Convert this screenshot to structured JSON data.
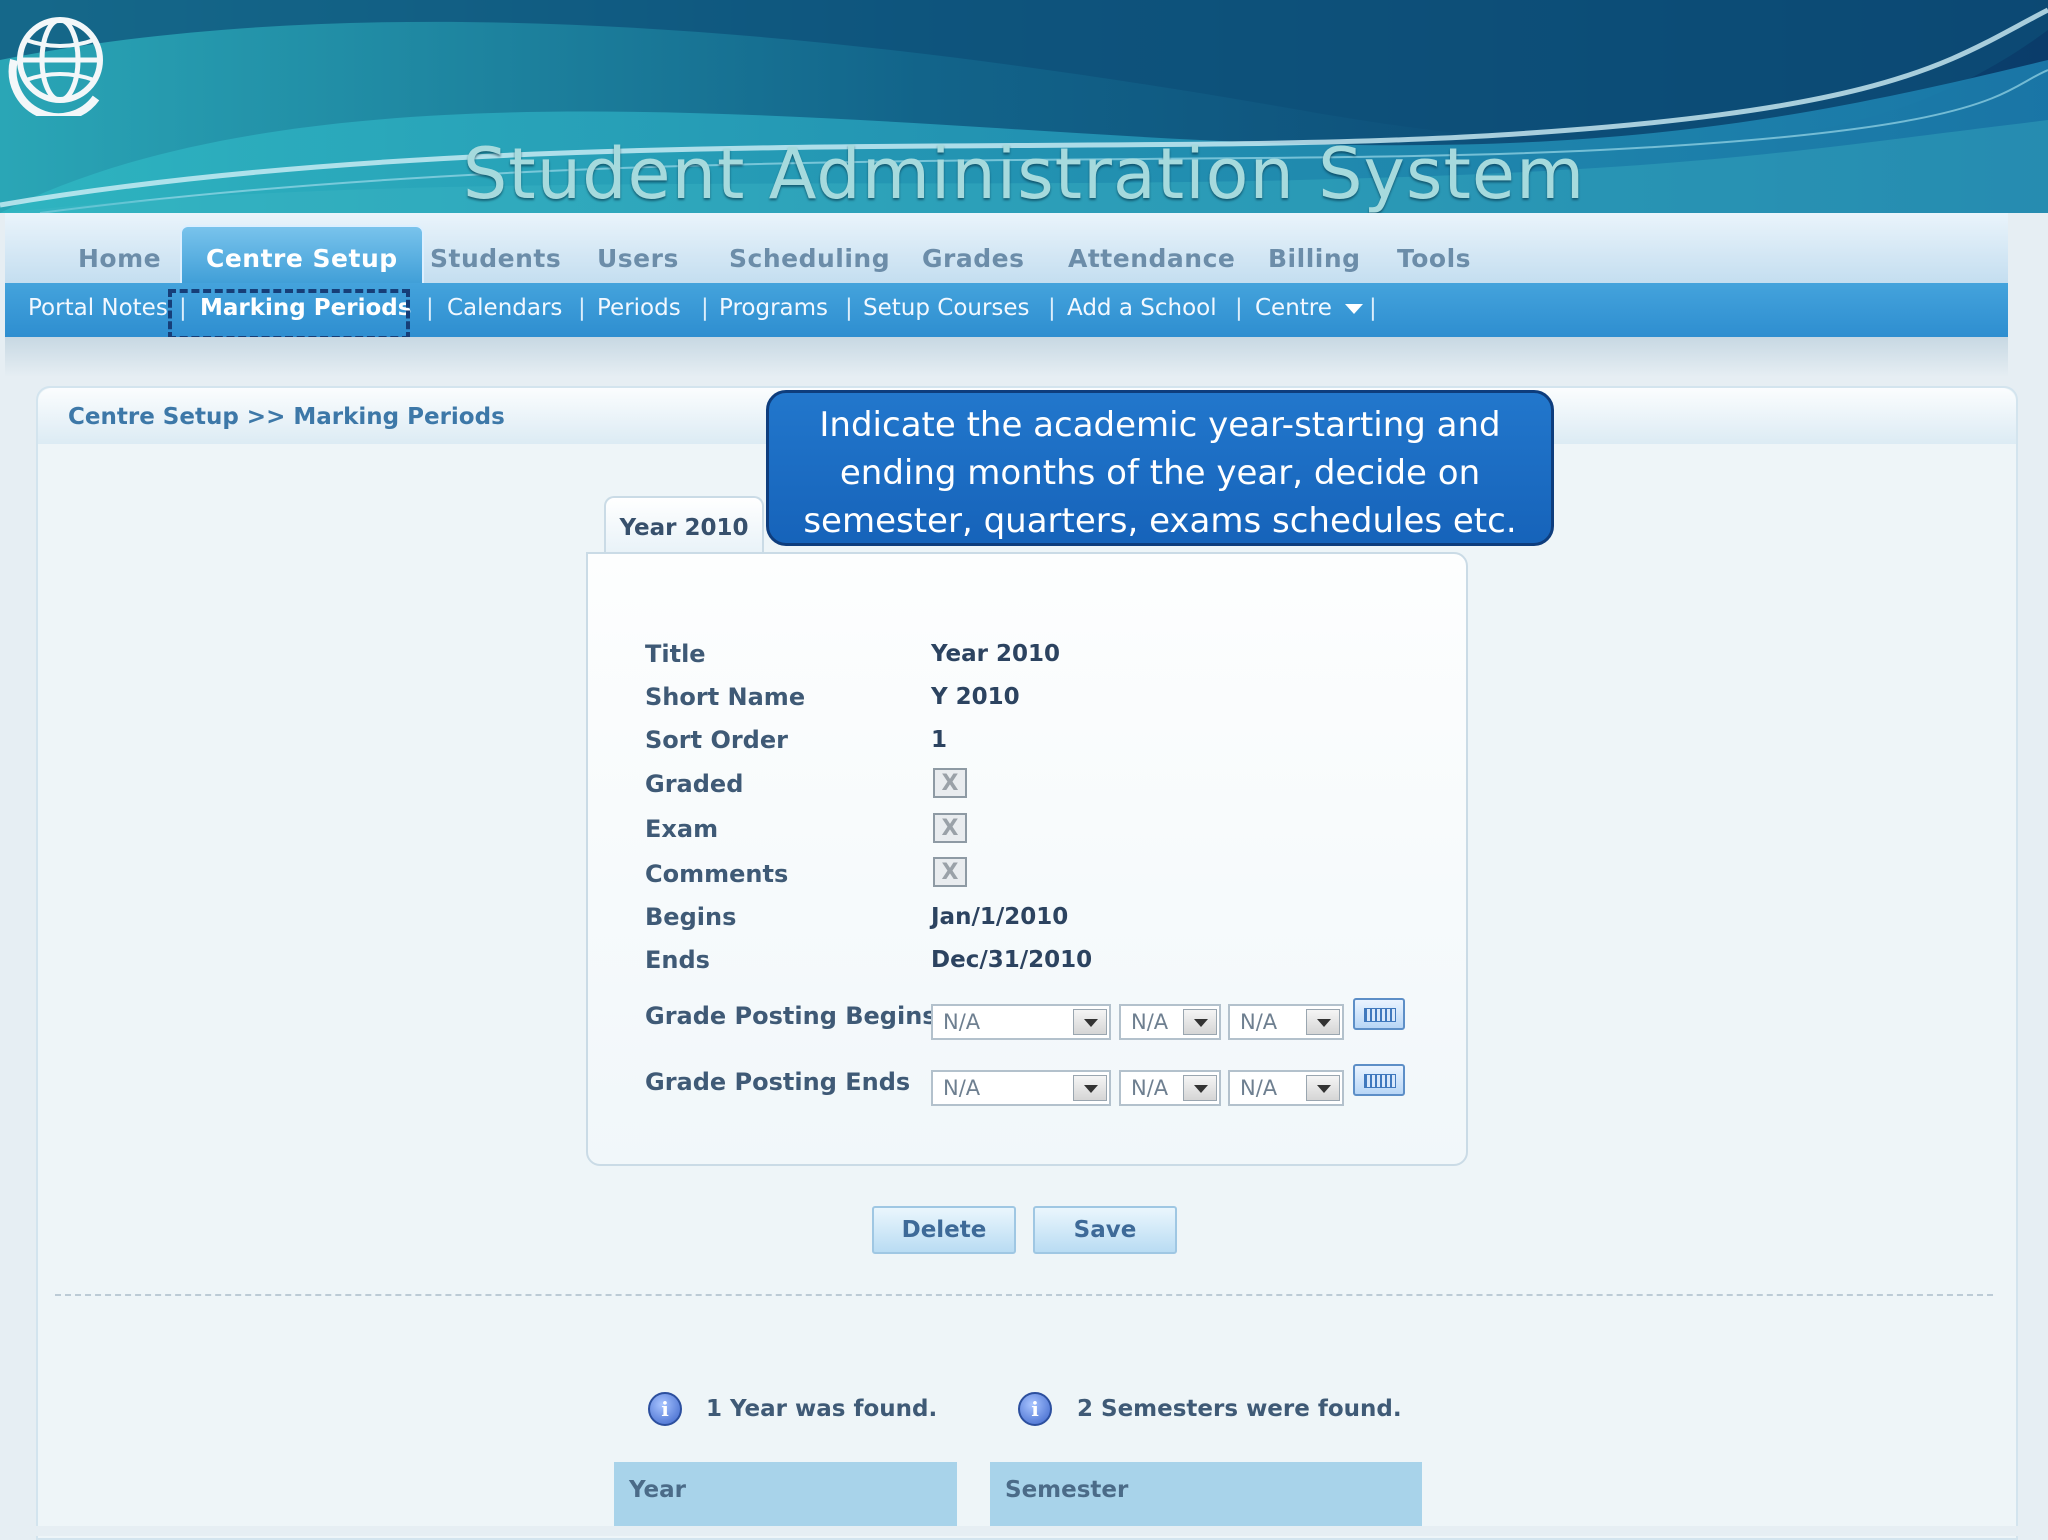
{
  "header": {
    "title": "Student Administration System"
  },
  "nav": {
    "tabs": [
      {
        "label": "Home"
      },
      {
        "label": "Centre Setup"
      },
      {
        "label": "Students"
      },
      {
        "label": "Users"
      },
      {
        "label": "Scheduling"
      },
      {
        "label": "Grades"
      },
      {
        "label": "Attendance"
      },
      {
        "label": "Billing"
      },
      {
        "label": "Tools"
      }
    ],
    "active_tab": "Centre Setup",
    "sub_items": [
      {
        "label": "Portal Notes"
      },
      {
        "label": "Marking Periods"
      },
      {
        "label": "Calendars"
      },
      {
        "label": "Periods"
      },
      {
        "label": "Programs"
      },
      {
        "label": "Setup Courses"
      },
      {
        "label": "Add a School"
      },
      {
        "label": "Centre"
      }
    ],
    "separator": "|",
    "active_sub": "Marking Periods"
  },
  "breadcrumb": "Centre Setup >> Marking Periods",
  "callout": "Indicate the academic year-starting and ending months of the year, decide on semester, quarters, exams schedules etc.",
  "year_tab": "Year 2010",
  "form": {
    "title_label": "Title",
    "title_value": "Year 2010",
    "short_name_label": "Short Name",
    "short_name_value": "Y 2010",
    "sort_order_label": "Sort Order",
    "sort_order_value": "1",
    "graded_label": "Graded",
    "graded_mark": "X",
    "exam_label": "Exam",
    "exam_mark": "X",
    "comments_label": "Comments",
    "comments_mark": "X",
    "begins_label": "Begins",
    "begins_value": "Jan/1/2010",
    "ends_label": "Ends",
    "ends_value": "Dec/31/2010",
    "grade_posting_begins_label": "Grade Posting Begins",
    "grade_posting_ends_label": "Grade Posting Ends",
    "select_value": "N/A"
  },
  "buttons": {
    "delete": "Delete",
    "save": "Save"
  },
  "info": {
    "year_found": "1 Year was found.",
    "semesters_found": "2 Semesters were found.",
    "icon_glyph": "i"
  },
  "tables": {
    "year_header": "Year",
    "semester_header": "Semester"
  },
  "colors": {
    "accent": "#2e8ed0",
    "callout": "#1663ba",
    "header_bg": "#a8d3ea"
  }
}
